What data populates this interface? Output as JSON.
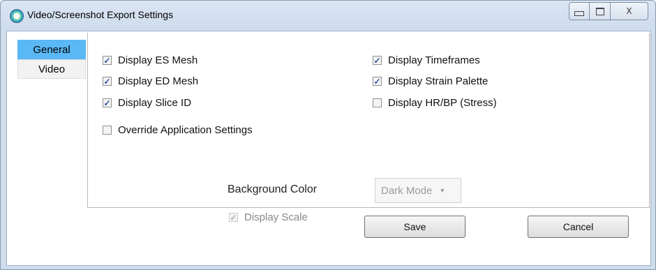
{
  "window": {
    "title": "Video/Screenshot Export Settings",
    "controls": {
      "minimize": "minimize",
      "maximize": "maximize",
      "close": "X"
    }
  },
  "tabs": [
    {
      "label": "General",
      "active": true
    },
    {
      "label": "Video",
      "active": false
    }
  ],
  "general": {
    "checkboxes_left": [
      {
        "label": "Display ES Mesh",
        "checked": true
      },
      {
        "label": "Display ED Mesh",
        "checked": true
      },
      {
        "label": "Display Slice ID",
        "checked": true
      },
      {
        "label": "Override Application Settings",
        "checked": false
      }
    ],
    "checkboxes_right": [
      {
        "label": "Display Timeframes",
        "checked": true
      },
      {
        "label": "Display Strain Palette",
        "checked": true
      },
      {
        "label": "Display HR/BP (Stress)",
        "checked": false
      }
    ],
    "background_color_label": "Background Color",
    "background_color_value": "Dark Mode",
    "display_scale_label": "Display Scale",
    "display_scale_checked": true
  },
  "buttons": {
    "save": "Save",
    "cancel": "Cancel"
  },
  "colors": {
    "active_tab": "#5ab8f5",
    "checkmark": "#2b4ea0"
  }
}
